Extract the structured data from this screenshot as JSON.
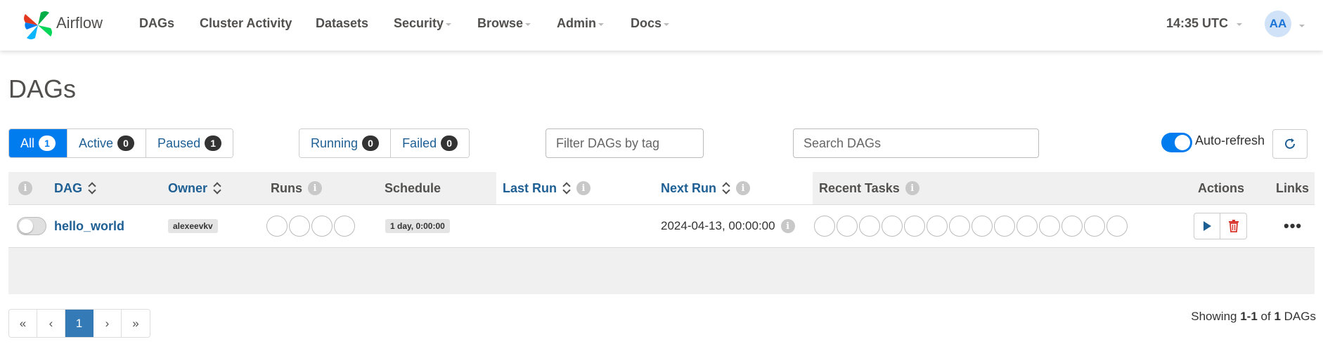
{
  "brand": {
    "name": "Airflow"
  },
  "nav": {
    "items": [
      {
        "label": "DAGs",
        "dropdown": false
      },
      {
        "label": "Cluster Activity",
        "dropdown": false
      },
      {
        "label": "Datasets",
        "dropdown": false
      },
      {
        "label": "Security",
        "dropdown": true
      },
      {
        "label": "Browse",
        "dropdown": true
      },
      {
        "label": "Admin",
        "dropdown": true
      },
      {
        "label": "Docs",
        "dropdown": true
      }
    ],
    "time": "14:35 UTC",
    "avatar_initials": "AA"
  },
  "page": {
    "title": "DAGs"
  },
  "status_filters": [
    {
      "label": "All",
      "count": "1",
      "active": true
    },
    {
      "label": "Active",
      "count": "0",
      "active": false
    },
    {
      "label": "Paused",
      "count": "1",
      "active": false
    }
  ],
  "run_filters": [
    {
      "label": "Running",
      "count": "0"
    },
    {
      "label": "Failed",
      "count": "0"
    }
  ],
  "tag_filter": {
    "placeholder": "Filter DAGs by tag",
    "value": ""
  },
  "search": {
    "placeholder": "Search DAGs",
    "value": ""
  },
  "auto_refresh": {
    "label": "Auto-refresh",
    "enabled": true
  },
  "table": {
    "headers": {
      "dag": "DAG",
      "owner": "Owner",
      "runs": "Runs",
      "schedule": "Schedule",
      "last_run": "Last Run",
      "next_run": "Next Run",
      "recent_tasks": "Recent Tasks",
      "actions": "Actions",
      "links": "Links"
    },
    "rows": [
      {
        "paused": true,
        "dag_id": "hello_world",
        "owner": "alexeevkv",
        "runs_circles": 4,
        "schedule": "1 day, 0:00:00",
        "last_run": "",
        "next_run": "2024-04-13, 00:00:00",
        "recent_task_circles": 14
      }
    ]
  },
  "pagination": {
    "first": "«",
    "prev": "‹",
    "current": "1",
    "next": "›",
    "last": "»"
  },
  "showing": {
    "prefix": "Showing",
    "range": "1-1",
    "of": "of",
    "total": "1",
    "suffix": "DAGs"
  },
  "colors": {
    "accent": "#017cee",
    "link": "#1e5f94",
    "page_active": "#337ab7"
  }
}
